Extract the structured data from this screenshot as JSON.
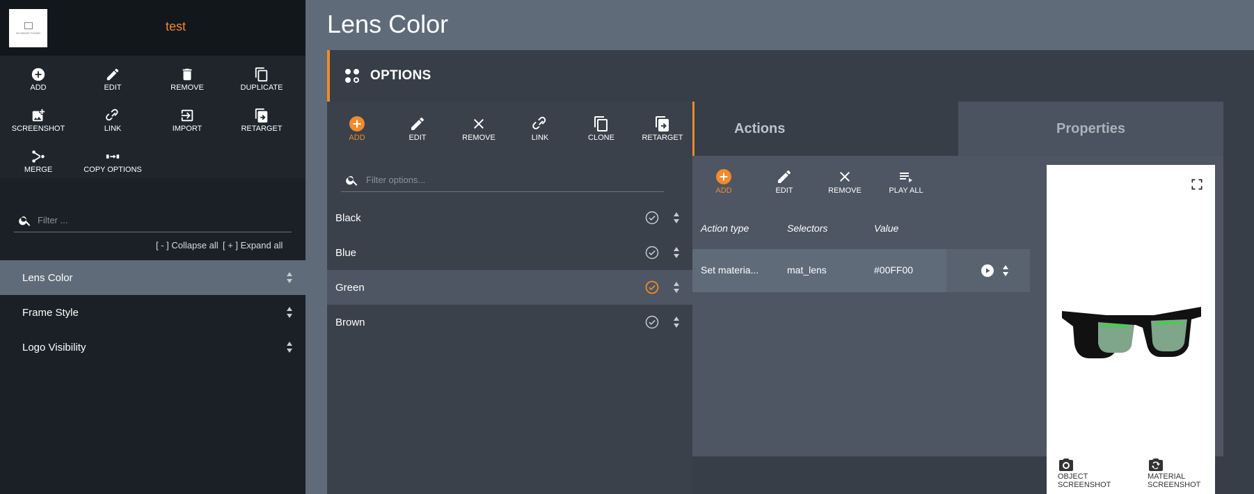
{
  "sidebar": {
    "logo_text": "NO IMAGE FOUND",
    "title": "test",
    "toolbar": [
      "ADD",
      "EDIT",
      "REMOVE",
      "DUPLICATE",
      "SCREENSHOT",
      "LINK",
      "IMPORT",
      "RETARGET",
      "MERGE",
      "COPY OPTIONS"
    ],
    "filter_placeholder": "Filter ...",
    "collapse_all": "[ - ] Collapse all",
    "expand_all": "[ + ] Expand all",
    "items": [
      {
        "label": "Lens Color",
        "active": true
      },
      {
        "label": "Frame Style",
        "active": false
      },
      {
        "label": "Logo Visibility",
        "active": false
      }
    ]
  },
  "main": {
    "title": "Lens Color",
    "options_header": "OPTIONS",
    "options_toolbar": [
      "ADD",
      "EDIT",
      "REMOVE",
      "LINK",
      "CLONE",
      "RETARGET"
    ],
    "filter_placeholder": "Filter options...",
    "options": [
      {
        "label": "Black",
        "selected": false
      },
      {
        "label": "Blue",
        "selected": false
      },
      {
        "label": "Green",
        "selected": true
      },
      {
        "label": "Brown",
        "selected": false
      }
    ],
    "tabs": {
      "actions": "Actions",
      "properties": "Properties"
    },
    "actions_toolbar": [
      "ADD",
      "EDIT",
      "REMOVE",
      "PLAY ALL"
    ],
    "table": {
      "headers": [
        "Action type",
        "Selectors",
        "Value"
      ],
      "row": {
        "action_type": "Set materia...",
        "selectors": "mat_lens",
        "value": "#00FF00"
      }
    },
    "preview": {
      "object_screenshot": "OBJECT SCREENSHOT",
      "material_screenshot": "MATERIAL SCREENSHOT"
    }
  },
  "colors": {
    "accent": "#f28a2c",
    "sidebar_bg": "#1b2026",
    "main_bg": "#5f6b79",
    "panel_bg": "#373e48",
    "lens_color": "#00FF00"
  }
}
